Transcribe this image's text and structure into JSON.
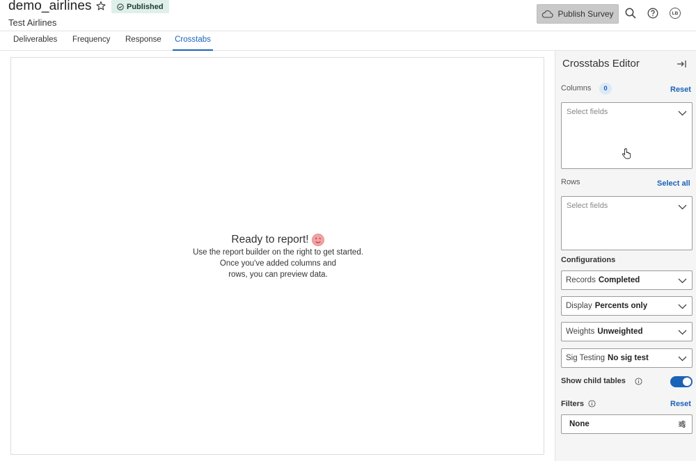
{
  "header": {
    "title": "demo_airlines",
    "subtitle": "Test Airlines",
    "status_badge": "Published",
    "publish_button": "Publish Survey",
    "avatar_initials": "LB"
  },
  "tabs": [
    {
      "label": "Deliverables",
      "active": false
    },
    {
      "label": "Frequency",
      "active": false
    },
    {
      "label": "Response",
      "active": false
    },
    {
      "label": "Crosstabs",
      "active": true
    }
  ],
  "main": {
    "empty_title": "Ready to report!",
    "empty_lines": [
      "Use the report builder on the right to get started.",
      "Once you've added columns and",
      "rows, you can preview data."
    ]
  },
  "editor": {
    "title": "Crosstabs Editor",
    "columns": {
      "label": "Columns",
      "count": "0",
      "action": "Reset",
      "placeholder": "Select fields"
    },
    "rows": {
      "label": "Rows",
      "action": "Select all",
      "placeholder": "Select fields"
    },
    "configurations_label": "Configurations",
    "configs": [
      {
        "key": "Records",
        "value": "Completed"
      },
      {
        "key": "Display",
        "value": "Percents only"
      },
      {
        "key": "Weights",
        "value": "Unweighted"
      },
      {
        "key": "Sig Testing",
        "value": "No sig test"
      }
    ],
    "show_child_tables": {
      "label": "Show child tables",
      "enabled": true
    },
    "filters": {
      "label": "Filters",
      "action": "Reset",
      "value": "None"
    }
  },
  "colors": {
    "accent": "#1a63b8",
    "badge_bg": "#dff0ea",
    "publish_bg": "#c9c9c9",
    "panel_bg": "#f5f5f5"
  },
  "icons": [
    "star-icon",
    "check-circle-icon",
    "cloud-icon",
    "search-icon",
    "help-icon",
    "collapse-panel-icon",
    "chevron-down-icon",
    "info-icon",
    "sliders-icon",
    "pointer-cursor-icon",
    "emoji-icon"
  ]
}
